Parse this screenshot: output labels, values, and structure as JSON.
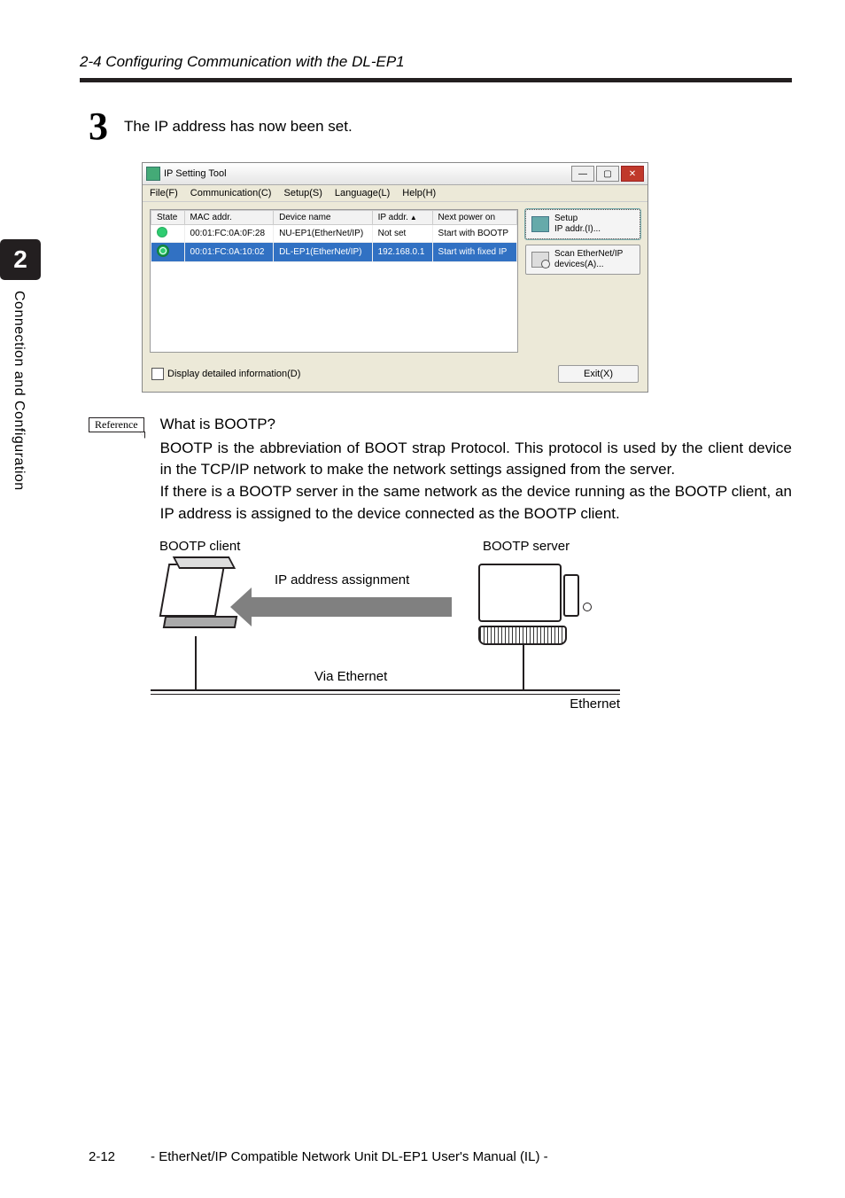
{
  "header": {
    "section_title": "2-4 Configuring Communication with the DL-EP1"
  },
  "side": {
    "chapter_number": "2",
    "chapter_title": "Connection and Configuration"
  },
  "step": {
    "number": "3",
    "text": "The IP address has now been set."
  },
  "app": {
    "title": "IP Setting Tool",
    "menus": [
      "File(F)",
      "Communication(C)",
      "Setup(S)",
      "Language(L)",
      "Help(H)"
    ],
    "columns": [
      "State",
      "MAC addr.",
      "Device name",
      "IP addr.",
      "Next power on"
    ],
    "rows": [
      {
        "state_icon": "green",
        "mac": "00:01:FC:0A:0F:28",
        "device": "NU-EP1(EtherNet/IP)",
        "ip": "Not set",
        "next": "Start with BOOTP",
        "selected": false
      },
      {
        "state_icon": "recycle",
        "mac": "00:01:FC:0A:10:02",
        "device": "DL-EP1(EtherNet/IP)",
        "ip": "192.168.0.1",
        "next": "Start with fixed IP",
        "selected": true
      }
    ],
    "buttons": {
      "setup_line1": "Setup",
      "setup_line2": "IP addr.(I)...",
      "scan_line1": "Scan EtherNet/IP",
      "scan_line2": "devices(A)..."
    },
    "footer": {
      "checkbox_label": "Display detailed information(D)",
      "exit_label": "Exit(X)"
    }
  },
  "reference": {
    "badge": "Reference",
    "heading": "What is BOOTP?",
    "para1": "BOOTP is the abbreviation of BOOT strap Protocol. This protocol is used by the client device in the TCP/IP network to make the network settings assigned from the server.",
    "para2": "If there is a BOOTP server in the same network as the device running as the BOOTP client, an IP address is assigned to the device connected as the BOOTP client."
  },
  "diagram": {
    "client_label": "BOOTP client",
    "server_label": "BOOTP server",
    "arrow_label": "IP address assignment",
    "via_label": "Via Ethernet",
    "ethernet_label": "Ethernet"
  },
  "footer": {
    "page_number": "2-12",
    "manual_title": "- EtherNet/IP Compatible Network Unit DL-EP1 User's Manual (IL) -"
  }
}
